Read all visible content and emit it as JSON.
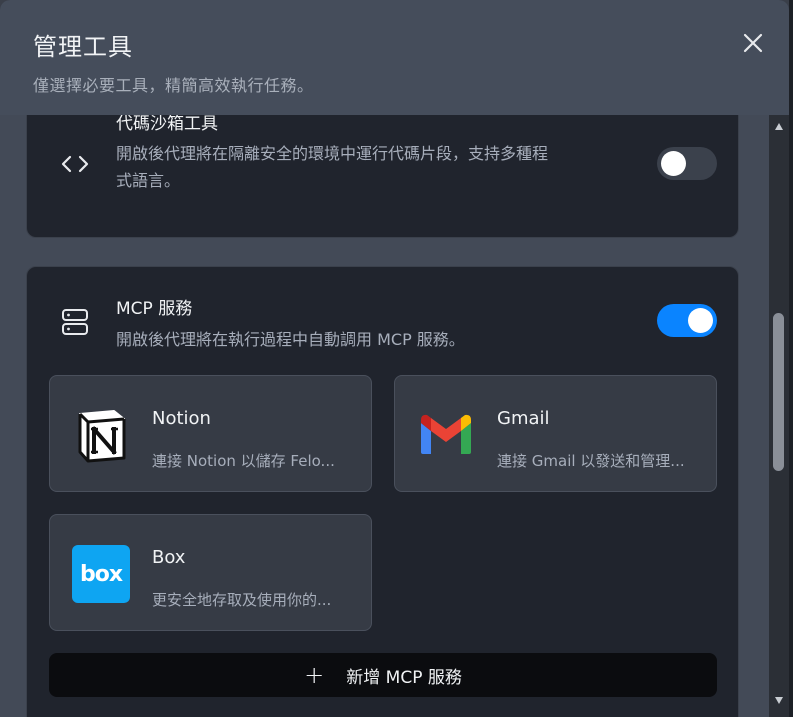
{
  "dialog": {
    "title": "管理工具",
    "subtitle": "僅選擇必要工具，精簡高效執行任務。"
  },
  "tools": {
    "code_sandbox": {
      "name": "代碼沙箱工具",
      "desc_line1": "開啟後代理將在隔離安全的環境中運行代碼片段，支持多種程",
      "desc_line2": "式語言。",
      "enabled": false,
      "icon": "code-brackets-icon"
    },
    "mcp": {
      "name": "MCP 服務",
      "desc": "開啟後代理將在執行過程中自動調用 MCP 服務。",
      "enabled": true,
      "icon": "server-icon",
      "services": [
        {
          "name": "Notion",
          "desc": "連接 Notion 以儲存 Felo...",
          "icon": "notion-logo"
        },
        {
          "name": "Gmail",
          "desc": "連接 Gmail 以發送和管理...",
          "icon": "gmail-logo"
        },
        {
          "name": "Box",
          "desc": "更安全地存取及使用你的...",
          "icon": "box-logo"
        }
      ],
      "add_label": "新增 MCP 服務",
      "add_icon_text": "+"
    }
  },
  "box_logo_text": "box",
  "colors": {
    "accent": "#0a84ff",
    "card_bg": "#20242d",
    "header_bg": "#454d5b",
    "box_blue": "#0ea5f2"
  }
}
